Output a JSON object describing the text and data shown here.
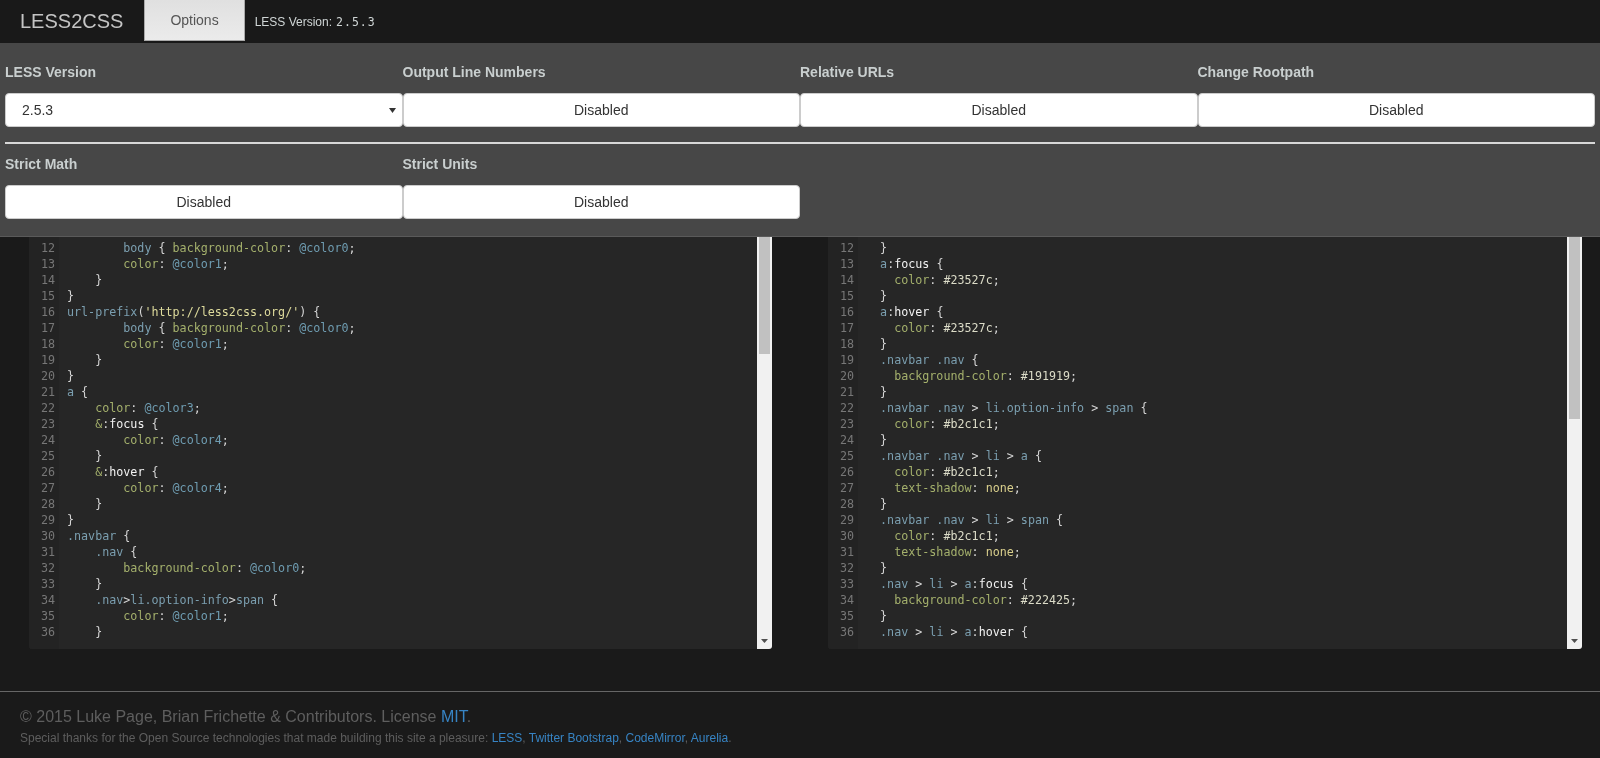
{
  "navbar": {
    "brand": "LESS2CSS",
    "tabs": [
      {
        "label": "Options",
        "selected": true
      }
    ],
    "info": {
      "label": "LESS Version:",
      "version": "2.5.3"
    }
  },
  "options": {
    "rows": [
      {
        "fields": [
          {
            "label": "LESS Version",
            "kind": "select",
            "value": "2.5.3"
          },
          {
            "label": "Output Line Numbers",
            "kind": "toggle",
            "value": "Disabled"
          },
          {
            "label": "Relative URLs",
            "kind": "toggle",
            "value": "Disabled"
          },
          {
            "label": "Change Rootpath",
            "kind": "toggle",
            "value": "Disabled"
          }
        ]
      },
      {
        "fields": [
          {
            "label": "Strict Math",
            "kind": "toggle",
            "value": "Disabled"
          },
          {
            "label": "Strict Units",
            "kind": "toggle",
            "value": "Disabled"
          }
        ]
      }
    ]
  },
  "editors": [
    {
      "lines": [
        {
          "number": "12",
          "tokens": [
            {
              "kind": "sel",
              "text": "        body"
            },
            {
              "kind": "punct",
              "text": " { "
            },
            {
              "kind": "prop",
              "text": "background-color"
            },
            {
              "kind": "punct",
              "text": ": "
            },
            {
              "kind": "var",
              "text": "@color0"
            },
            {
              "kind": "punct",
              "text": ";"
            }
          ]
        },
        {
          "number": "13",
          "tokens": [
            {
              "kind": "prop",
              "text": "        color"
            },
            {
              "kind": "punct",
              "text": ": "
            },
            {
              "kind": "var",
              "text": "@color1"
            },
            {
              "kind": "punct",
              "text": ";"
            }
          ]
        },
        {
          "number": "14",
          "tokens": [
            {
              "kind": "punct",
              "text": "    }"
            }
          ]
        },
        {
          "number": "15",
          "tokens": [
            {
              "kind": "punct",
              "text": "}"
            }
          ]
        },
        {
          "number": "16",
          "tokens": [
            {
              "kind": "sel",
              "text": "url-prefix"
            },
            {
              "kind": "punct",
              "text": "("
            },
            {
              "kind": "str",
              "text": "'http://less2css.org/'"
            },
            {
              "kind": "punct",
              "text": ") {"
            }
          ]
        },
        {
          "number": "17",
          "tokens": [
            {
              "kind": "sel",
              "text": "        body"
            },
            {
              "kind": "punct",
              "text": " { "
            },
            {
              "kind": "prop",
              "text": "background-color"
            },
            {
              "kind": "punct",
              "text": ": "
            },
            {
              "kind": "var",
              "text": "@color0"
            },
            {
              "kind": "punct",
              "text": ";"
            }
          ]
        },
        {
          "number": "18",
          "tokens": [
            {
              "kind": "prop",
              "text": "        color"
            },
            {
              "kind": "punct",
              "text": ": "
            },
            {
              "kind": "var",
              "text": "@color1"
            },
            {
              "kind": "punct",
              "text": ";"
            }
          ]
        },
        {
          "number": "19",
          "tokens": [
            {
              "kind": "punct",
              "text": "    }"
            }
          ]
        },
        {
          "number": "20",
          "tokens": [
            {
              "kind": "punct",
              "text": "}"
            }
          ]
        },
        {
          "number": "21",
          "tokens": [
            {
              "kind": "sel",
              "text": "a"
            },
            {
              "kind": "punct",
              "text": " {"
            }
          ]
        },
        {
          "number": "22",
          "tokens": [
            {
              "kind": "prop",
              "text": "    color"
            },
            {
              "kind": "punct",
              "text": ": "
            },
            {
              "kind": "var",
              "text": "@color3"
            },
            {
              "kind": "punct",
              "text": ";"
            }
          ]
        },
        {
          "number": "23",
          "tokens": [
            {
              "kind": "prop",
              "text": "    &"
            },
            {
              "kind": "punct",
              "text": ":"
            },
            {
              "kind": "pseudo",
              "text": "focus"
            },
            {
              "kind": "punct",
              "text": " {"
            }
          ]
        },
        {
          "number": "24",
          "tokens": [
            {
              "kind": "prop",
              "text": "        color"
            },
            {
              "kind": "punct",
              "text": ": "
            },
            {
              "kind": "var",
              "text": "@color4"
            },
            {
              "kind": "punct",
              "text": ";"
            }
          ]
        },
        {
          "number": "25",
          "tokens": [
            {
              "kind": "punct",
              "text": "    }"
            }
          ]
        },
        {
          "number": "26",
          "tokens": [
            {
              "kind": "prop",
              "text": "    &"
            },
            {
              "kind": "punct",
              "text": ":"
            },
            {
              "kind": "pseudo",
              "text": "hover"
            },
            {
              "kind": "punct",
              "text": " {"
            }
          ]
        },
        {
          "number": "27",
          "tokens": [
            {
              "kind": "prop",
              "text": "        color"
            },
            {
              "kind": "punct",
              "text": ": "
            },
            {
              "kind": "var",
              "text": "@color4"
            },
            {
              "kind": "punct",
              "text": ";"
            }
          ]
        },
        {
          "number": "28",
          "tokens": [
            {
              "kind": "punct",
              "text": "    }"
            }
          ]
        },
        {
          "number": "29",
          "tokens": [
            {
              "kind": "punct",
              "text": "}"
            }
          ]
        },
        {
          "number": "30",
          "tokens": [
            {
              "kind": "sel",
              "text": ".navbar"
            },
            {
              "kind": "punct",
              "text": " {"
            }
          ]
        },
        {
          "number": "31",
          "tokens": [
            {
              "kind": "sel",
              "text": "    .nav"
            },
            {
              "kind": "punct",
              "text": " {"
            }
          ]
        },
        {
          "number": "32",
          "tokens": [
            {
              "kind": "prop",
              "text": "        background-color"
            },
            {
              "kind": "punct",
              "text": ": "
            },
            {
              "kind": "var",
              "text": "@color0"
            },
            {
              "kind": "punct",
              "text": ";"
            }
          ]
        },
        {
          "number": "33",
          "tokens": [
            {
              "kind": "punct",
              "text": "    }"
            }
          ]
        },
        {
          "number": "34",
          "tokens": [
            {
              "kind": "sel",
              "text": "    .nav"
            },
            {
              "kind": "punct",
              "text": ">"
            },
            {
              "kind": "sel",
              "text": "li.option-info"
            },
            {
              "kind": "punct",
              "text": ">"
            },
            {
              "kind": "sel",
              "text": "span"
            },
            {
              "kind": "punct",
              "text": " {"
            }
          ]
        },
        {
          "number": "35",
          "tokens": [
            {
              "kind": "prop",
              "text": "        color"
            },
            {
              "kind": "punct",
              "text": ": "
            },
            {
              "kind": "var",
              "text": "@color1"
            },
            {
              "kind": "punct",
              "text": ";"
            }
          ]
        },
        {
          "number": "36",
          "tokens": [
            {
              "kind": "punct",
              "text": "    }"
            }
          ]
        }
      ]
    },
    {
      "lines": [
        {
          "number": "12",
          "tokens": [
            {
              "kind": "punct",
              "text": "  }"
            }
          ]
        },
        {
          "number": "13",
          "tokens": [
            {
              "kind": "sel",
              "text": "  a"
            },
            {
              "kind": "punct",
              "text": ":"
            },
            {
              "kind": "pseudo",
              "text": "focus"
            },
            {
              "kind": "punct",
              "text": " {"
            }
          ]
        },
        {
          "number": "14",
          "tokens": [
            {
              "kind": "prop",
              "text": "    color"
            },
            {
              "kind": "punct",
              "text": ": "
            },
            {
              "kind": "value",
              "text": "#23527c"
            },
            {
              "kind": "punct",
              "text": ";"
            }
          ]
        },
        {
          "number": "15",
          "tokens": [
            {
              "kind": "punct",
              "text": "  }"
            }
          ]
        },
        {
          "number": "16",
          "tokens": [
            {
              "kind": "sel",
              "text": "  a"
            },
            {
              "kind": "punct",
              "text": ":"
            },
            {
              "kind": "pseudo",
              "text": "hover"
            },
            {
              "kind": "punct",
              "text": " {"
            }
          ]
        },
        {
          "number": "17",
          "tokens": [
            {
              "kind": "prop",
              "text": "    color"
            },
            {
              "kind": "punct",
              "text": ": "
            },
            {
              "kind": "value",
              "text": "#23527c"
            },
            {
              "kind": "punct",
              "text": ";"
            }
          ]
        },
        {
          "number": "18",
          "tokens": [
            {
              "kind": "punct",
              "text": "  }"
            }
          ]
        },
        {
          "number": "19",
          "tokens": [
            {
              "kind": "sel",
              "text": "  .navbar .nav"
            },
            {
              "kind": "punct",
              "text": " {"
            }
          ]
        },
        {
          "number": "20",
          "tokens": [
            {
              "kind": "prop",
              "text": "    background-color"
            },
            {
              "kind": "punct",
              "text": ": "
            },
            {
              "kind": "value",
              "text": "#191919"
            },
            {
              "kind": "punct",
              "text": ";"
            }
          ]
        },
        {
          "number": "21",
          "tokens": [
            {
              "kind": "punct",
              "text": "  }"
            }
          ]
        },
        {
          "number": "22",
          "tokens": [
            {
              "kind": "sel",
              "text": "  .navbar .nav"
            },
            {
              "kind": "punct",
              "text": " > "
            },
            {
              "kind": "sel",
              "text": "li.option-info"
            },
            {
              "kind": "punct",
              "text": " > "
            },
            {
              "kind": "sel",
              "text": "span"
            },
            {
              "kind": "punct",
              "text": " {"
            }
          ]
        },
        {
          "number": "23",
          "tokens": [
            {
              "kind": "prop",
              "text": "    color"
            },
            {
              "kind": "punct",
              "text": ": "
            },
            {
              "kind": "value",
              "text": "#b2c1c1"
            },
            {
              "kind": "punct",
              "text": ";"
            }
          ]
        },
        {
          "number": "24",
          "tokens": [
            {
              "kind": "punct",
              "text": "  }"
            }
          ]
        },
        {
          "number": "25",
          "tokens": [
            {
              "kind": "sel",
              "text": "  .navbar .nav"
            },
            {
              "kind": "punct",
              "text": " > "
            },
            {
              "kind": "sel",
              "text": "li"
            },
            {
              "kind": "punct",
              "text": " > "
            },
            {
              "kind": "sel",
              "text": "a"
            },
            {
              "kind": "punct",
              "text": " {"
            }
          ]
        },
        {
          "number": "26",
          "tokens": [
            {
              "kind": "prop",
              "text": "    color"
            },
            {
              "kind": "punct",
              "text": ": "
            },
            {
              "kind": "value",
              "text": "#b2c1c1"
            },
            {
              "kind": "punct",
              "text": ";"
            }
          ]
        },
        {
          "number": "27",
          "tokens": [
            {
              "kind": "prop",
              "text": "    text-shadow"
            },
            {
              "kind": "punct",
              "text": ": "
            },
            {
              "kind": "atom",
              "text": "none"
            },
            {
              "kind": "punct",
              "text": ";"
            }
          ]
        },
        {
          "number": "28",
          "tokens": [
            {
              "kind": "punct",
              "text": "  }"
            }
          ]
        },
        {
          "number": "29",
          "tokens": [
            {
              "kind": "sel",
              "text": "  .navbar .nav"
            },
            {
              "kind": "punct",
              "text": " > "
            },
            {
              "kind": "sel",
              "text": "li"
            },
            {
              "kind": "punct",
              "text": " > "
            },
            {
              "kind": "sel",
              "text": "span"
            },
            {
              "kind": "punct",
              "text": " {"
            }
          ]
        },
        {
          "number": "30",
          "tokens": [
            {
              "kind": "prop",
              "text": "    color"
            },
            {
              "kind": "punct",
              "text": ": "
            },
            {
              "kind": "value",
              "text": "#b2c1c1"
            },
            {
              "kind": "punct",
              "text": ";"
            }
          ]
        },
        {
          "number": "31",
          "tokens": [
            {
              "kind": "prop",
              "text": "    text-shadow"
            },
            {
              "kind": "punct",
              "text": ": "
            },
            {
              "kind": "atom",
              "text": "none"
            },
            {
              "kind": "punct",
              "text": ";"
            }
          ]
        },
        {
          "number": "32",
          "tokens": [
            {
              "kind": "punct",
              "text": "  }"
            }
          ]
        },
        {
          "number": "33",
          "tokens": [
            {
              "kind": "sel",
              "text": "  .nav"
            },
            {
              "kind": "punct",
              "text": " > "
            },
            {
              "kind": "sel",
              "text": "li"
            },
            {
              "kind": "punct",
              "text": " > "
            },
            {
              "kind": "sel",
              "text": "a"
            },
            {
              "kind": "punct",
              "text": ":"
            },
            {
              "kind": "pseudo",
              "text": "focus"
            },
            {
              "kind": "punct",
              "text": " {"
            }
          ]
        },
        {
          "number": "34",
          "tokens": [
            {
              "kind": "prop",
              "text": "    background-color"
            },
            {
              "kind": "punct",
              "text": ": "
            },
            {
              "kind": "value",
              "text": "#222425"
            },
            {
              "kind": "punct",
              "text": ";"
            }
          ]
        },
        {
          "number": "35",
          "tokens": [
            {
              "kind": "punct",
              "text": "  }"
            }
          ]
        },
        {
          "number": "36",
          "tokens": [
            {
              "kind": "sel",
              "text": "  .nav"
            },
            {
              "kind": "punct",
              "text": " > "
            },
            {
              "kind": "sel",
              "text": "li"
            },
            {
              "kind": "punct",
              "text": " > "
            },
            {
              "kind": "sel",
              "text": "a"
            },
            {
              "kind": "punct",
              "text": ":"
            },
            {
              "kind": "pseudo",
              "text": "hover"
            },
            {
              "kind": "punct",
              "text": " {"
            }
          ]
        }
      ]
    }
  ],
  "footer": {
    "copyright": {
      "text": "© 2015 Luke Page, Brian Frichette & Contributors. License",
      "links": [
        {
          "label": "MIT",
          "after": "."
        }
      ]
    },
    "thanks": {
      "text": "Special thanks for the Open Source technologies that made building this site a pleasure:",
      "links": [
        {
          "label": "LESS",
          "after": ","
        },
        {
          "label": "Twitter Bootstrap",
          "after": ","
        },
        {
          "label": "CodeMirror",
          "after": ","
        },
        {
          "label": "Aurelia",
          "after": "."
        }
      ]
    }
  }
}
